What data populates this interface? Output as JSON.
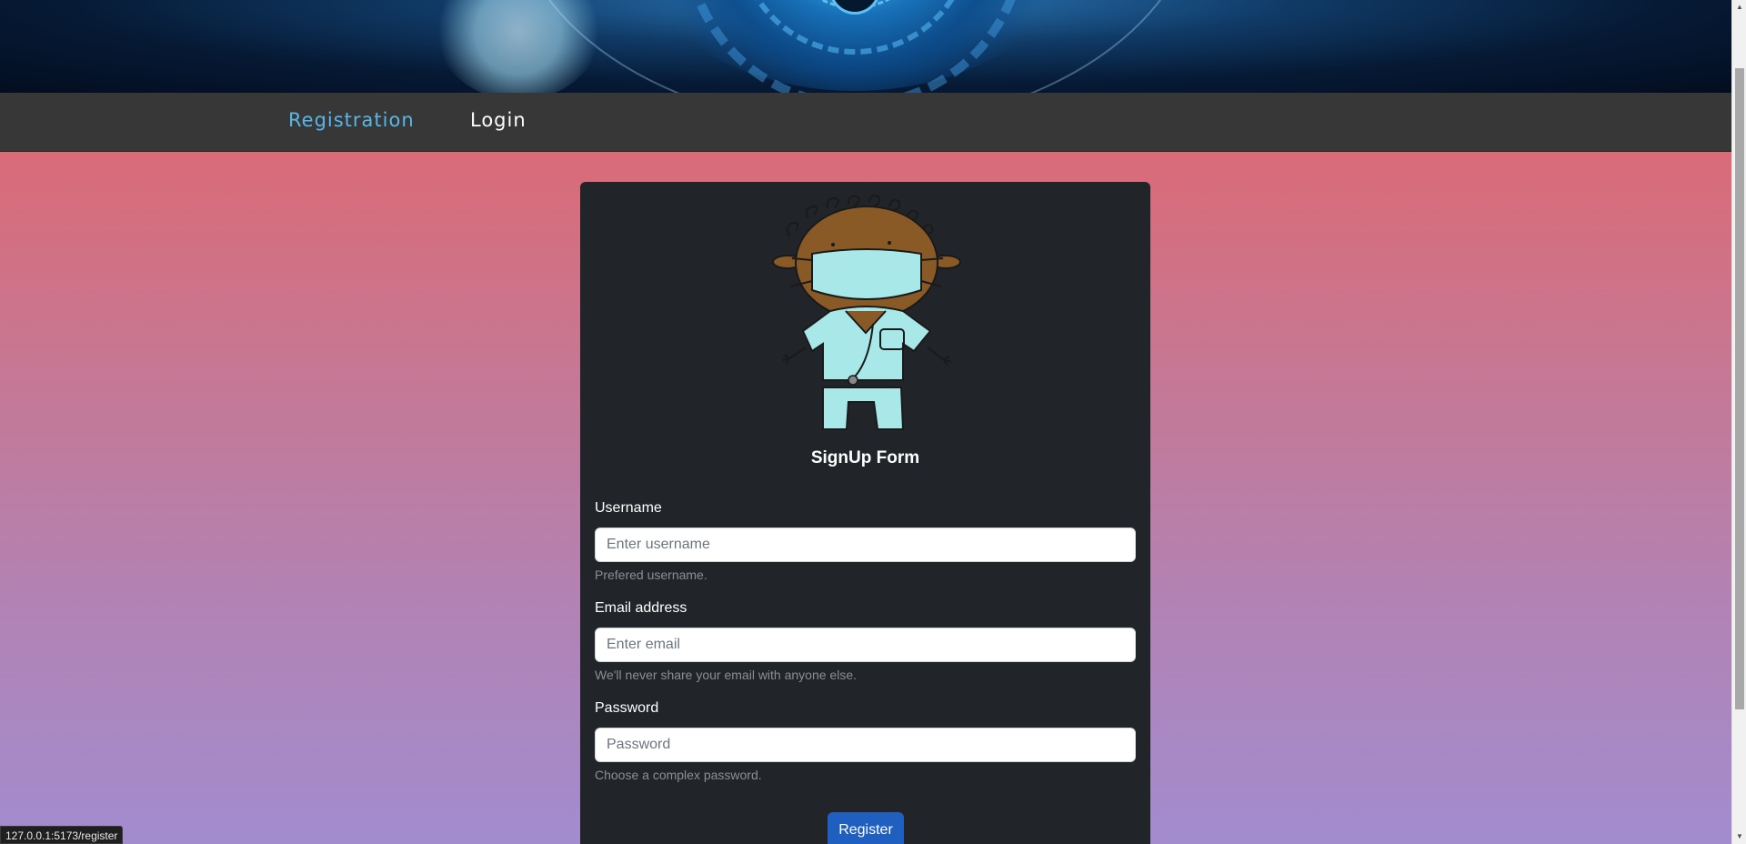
{
  "nav": {
    "registration": "Registration",
    "login": "Login"
  },
  "form": {
    "title": "SignUp Form",
    "username": {
      "label": "Username",
      "placeholder": "Enter username",
      "help": "Prefered username."
    },
    "email": {
      "label": "Email address",
      "placeholder": "Enter email",
      "help": "We'll never share your email with anyone else."
    },
    "password": {
      "label": "Password",
      "placeholder": "Password",
      "help": "Choose a complex password."
    },
    "submit_label": "Register"
  },
  "status_bar": {
    "url": "127.0.0.1:5173/register"
  },
  "colors": {
    "nav_active": "#58b7e8",
    "card_bg": "#212529",
    "button_bg": "#1f5fbf"
  },
  "icons": [
    "doctor-avatar-illustration"
  ]
}
